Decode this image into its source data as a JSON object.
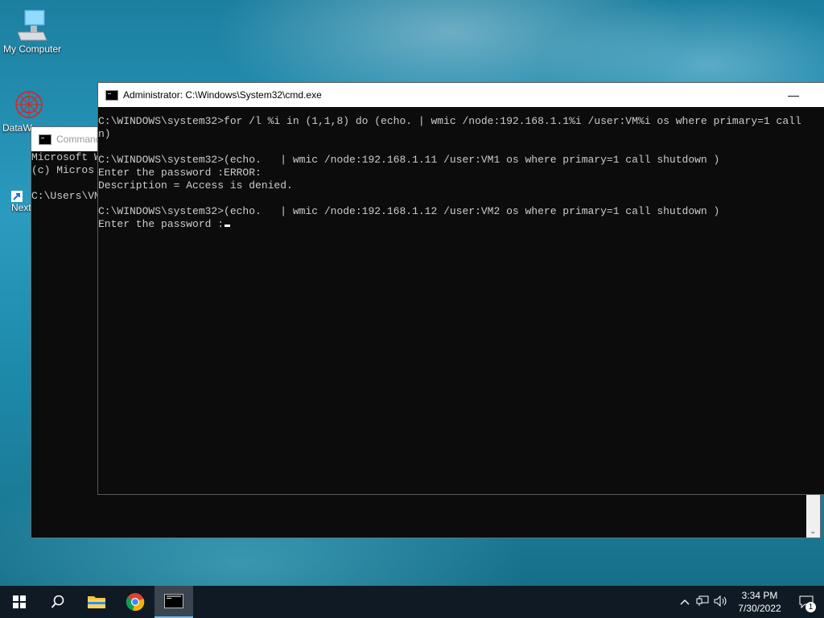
{
  "desktop": {
    "icons": [
      {
        "label": "My Computer"
      },
      {
        "label": "DataW"
      },
      {
        "label": "Next"
      }
    ]
  },
  "background_window": {
    "title": "Command",
    "lines": [
      "Microsoft W",
      "(c) Micros",
      "",
      "C:\\Users\\VM"
    ]
  },
  "cmd_window": {
    "title": "Administrator: C:\\Windows\\System32\\cmd.exe",
    "lines": [
      "C:\\WINDOWS\\system32>for /l %i in (1,1,8) do (echo. | wmic /node:192.168.1.1%i /user:VM%i os where primary=1 call",
      "n)",
      "",
      "C:\\WINDOWS\\system32>(echo.   | wmic /node:192.168.1.11 /user:VM1 os where primary=1 call shutdown )",
      "Enter the password :ERROR:",
      "Description = Access is denied.",
      "",
      "C:\\WINDOWS\\system32>(echo.   | wmic /node:192.168.1.12 /user:VM2 os where primary=1 call shutdown )"
    ],
    "prompt_line": "Enter the password :"
  },
  "taskbar": {
    "time": "3:34 PM",
    "date": "7/30/2022",
    "notification_count": "1"
  }
}
